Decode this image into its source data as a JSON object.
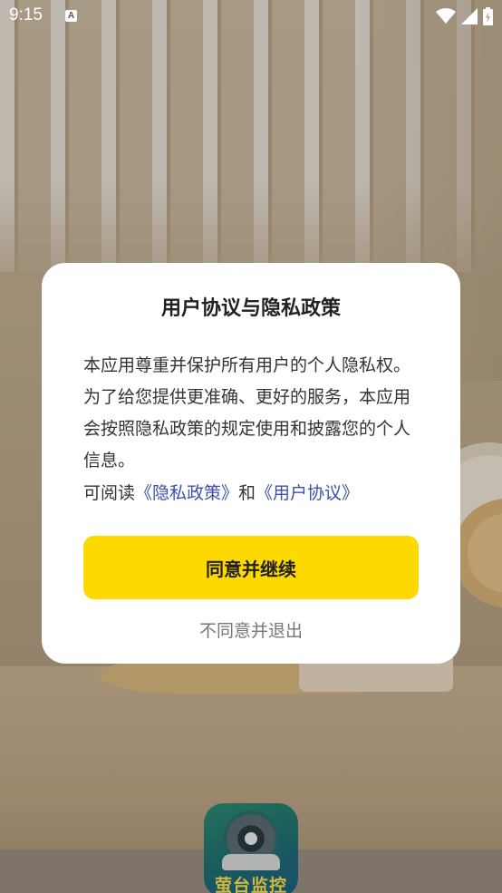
{
  "status_bar": {
    "time": "9:15",
    "notification_icon": "text-a-icon",
    "icons": [
      "wifi-icon",
      "cellular-signal-icon",
      "battery-charging-icon"
    ]
  },
  "app": {
    "logo_text": "萤台监控",
    "logo_icon": "camera-icon"
  },
  "dialog": {
    "title": "用户协议与隐私政策",
    "body": "本应用尊重并保护所有用户的个人隐私权。为了给您提供更准确、更好的服务，本应用会按照隐私政策的规定使用和披露您的个人信息。",
    "links_prefix": "可阅读",
    "privacy_link": "《隐私政策》",
    "links_joiner": "和",
    "user_agreement_link": "《用户协议》",
    "agree_button": "同意并继续",
    "disagree_button": "不同意并退出"
  },
  "colors": {
    "accent": "#fdd900",
    "link": "#3d4eb0"
  }
}
